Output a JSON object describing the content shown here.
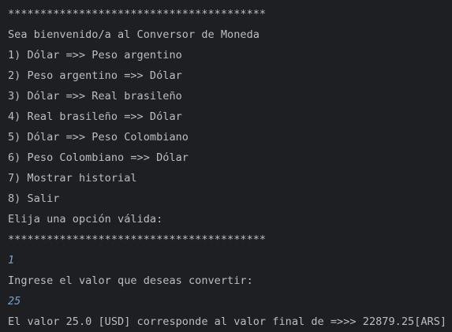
{
  "console": {
    "separator_top": "****************************************",
    "welcome": "Sea bienvenido/a al Conversor de Moneda",
    "menu": [
      "1) Dólar =>> Peso argentino",
      "2) Peso argentino =>> Dólar",
      "3) Dólar =>> Real brasileño",
      "4) Real brasileño =>> Dólar",
      "5) Dólar =>> Peso Colombiano",
      "6) Peso Colombiano =>> Dólar",
      "7) Mostrar historial",
      "8) Salir"
    ],
    "prompt_option": "Elija una opción válida:",
    "separator_bottom": "****************************************",
    "user_option": "1",
    "prompt_value": "Ingrese el valor que deseas convertir:",
    "user_value": "25",
    "result": "El valor 25.0 [USD] corresponde al valor final de =>>> 22879.25[ARS]"
  },
  "colors": {
    "background": "#1e1f22",
    "text": "#bcbec4",
    "user_input": "#7ca0c7"
  }
}
